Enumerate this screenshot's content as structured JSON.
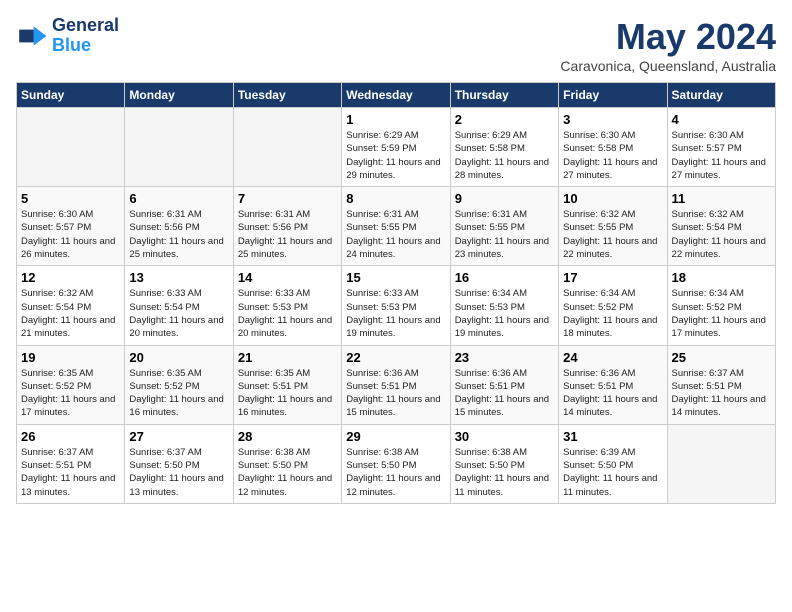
{
  "logo": {
    "text1": "General",
    "text2": "Blue"
  },
  "title": "May 2024",
  "location": "Caravonica, Queensland, Australia",
  "days_header": [
    "Sunday",
    "Monday",
    "Tuesday",
    "Wednesday",
    "Thursday",
    "Friday",
    "Saturday"
  ],
  "weeks": [
    [
      {
        "num": "",
        "empty": true
      },
      {
        "num": "",
        "empty": true
      },
      {
        "num": "",
        "empty": true
      },
      {
        "num": "1",
        "sunrise": "6:29 AM",
        "sunset": "5:59 PM",
        "daylight": "11 hours and 29 minutes."
      },
      {
        "num": "2",
        "sunrise": "6:29 AM",
        "sunset": "5:58 PM",
        "daylight": "11 hours and 28 minutes."
      },
      {
        "num": "3",
        "sunrise": "6:30 AM",
        "sunset": "5:58 PM",
        "daylight": "11 hours and 27 minutes."
      },
      {
        "num": "4",
        "sunrise": "6:30 AM",
        "sunset": "5:57 PM",
        "daylight": "11 hours and 27 minutes."
      }
    ],
    [
      {
        "num": "5",
        "sunrise": "6:30 AM",
        "sunset": "5:57 PM",
        "daylight": "11 hours and 26 minutes."
      },
      {
        "num": "6",
        "sunrise": "6:31 AM",
        "sunset": "5:56 PM",
        "daylight": "11 hours and 25 minutes."
      },
      {
        "num": "7",
        "sunrise": "6:31 AM",
        "sunset": "5:56 PM",
        "daylight": "11 hours and 25 minutes."
      },
      {
        "num": "8",
        "sunrise": "6:31 AM",
        "sunset": "5:55 PM",
        "daylight": "11 hours and 24 minutes."
      },
      {
        "num": "9",
        "sunrise": "6:31 AM",
        "sunset": "5:55 PM",
        "daylight": "11 hours and 23 minutes."
      },
      {
        "num": "10",
        "sunrise": "6:32 AM",
        "sunset": "5:55 PM",
        "daylight": "11 hours and 22 minutes."
      },
      {
        "num": "11",
        "sunrise": "6:32 AM",
        "sunset": "5:54 PM",
        "daylight": "11 hours and 22 minutes."
      }
    ],
    [
      {
        "num": "12",
        "sunrise": "6:32 AM",
        "sunset": "5:54 PM",
        "daylight": "11 hours and 21 minutes."
      },
      {
        "num": "13",
        "sunrise": "6:33 AM",
        "sunset": "5:54 PM",
        "daylight": "11 hours and 20 minutes."
      },
      {
        "num": "14",
        "sunrise": "6:33 AM",
        "sunset": "5:53 PM",
        "daylight": "11 hours and 20 minutes."
      },
      {
        "num": "15",
        "sunrise": "6:33 AM",
        "sunset": "5:53 PM",
        "daylight": "11 hours and 19 minutes."
      },
      {
        "num": "16",
        "sunrise": "6:34 AM",
        "sunset": "5:53 PM",
        "daylight": "11 hours and 19 minutes."
      },
      {
        "num": "17",
        "sunrise": "6:34 AM",
        "sunset": "5:52 PM",
        "daylight": "11 hours and 18 minutes."
      },
      {
        "num": "18",
        "sunrise": "6:34 AM",
        "sunset": "5:52 PM",
        "daylight": "11 hours and 17 minutes."
      }
    ],
    [
      {
        "num": "19",
        "sunrise": "6:35 AM",
        "sunset": "5:52 PM",
        "daylight": "11 hours and 17 minutes."
      },
      {
        "num": "20",
        "sunrise": "6:35 AM",
        "sunset": "5:52 PM",
        "daylight": "11 hours and 16 minutes."
      },
      {
        "num": "21",
        "sunrise": "6:35 AM",
        "sunset": "5:51 PM",
        "daylight": "11 hours and 16 minutes."
      },
      {
        "num": "22",
        "sunrise": "6:36 AM",
        "sunset": "5:51 PM",
        "daylight": "11 hours and 15 minutes."
      },
      {
        "num": "23",
        "sunrise": "6:36 AM",
        "sunset": "5:51 PM",
        "daylight": "11 hours and 15 minutes."
      },
      {
        "num": "24",
        "sunrise": "6:36 AM",
        "sunset": "5:51 PM",
        "daylight": "11 hours and 14 minutes."
      },
      {
        "num": "25",
        "sunrise": "6:37 AM",
        "sunset": "5:51 PM",
        "daylight": "11 hours and 14 minutes."
      }
    ],
    [
      {
        "num": "26",
        "sunrise": "6:37 AM",
        "sunset": "5:51 PM",
        "daylight": "11 hours and 13 minutes."
      },
      {
        "num": "27",
        "sunrise": "6:37 AM",
        "sunset": "5:50 PM",
        "daylight": "11 hours and 13 minutes."
      },
      {
        "num": "28",
        "sunrise": "6:38 AM",
        "sunset": "5:50 PM",
        "daylight": "11 hours and 12 minutes."
      },
      {
        "num": "29",
        "sunrise": "6:38 AM",
        "sunset": "5:50 PM",
        "daylight": "11 hours and 12 minutes."
      },
      {
        "num": "30",
        "sunrise": "6:38 AM",
        "sunset": "5:50 PM",
        "daylight": "11 hours and 11 minutes."
      },
      {
        "num": "31",
        "sunrise": "6:39 AM",
        "sunset": "5:50 PM",
        "daylight": "11 hours and 11 minutes."
      },
      {
        "num": "",
        "empty": true
      }
    ]
  ]
}
